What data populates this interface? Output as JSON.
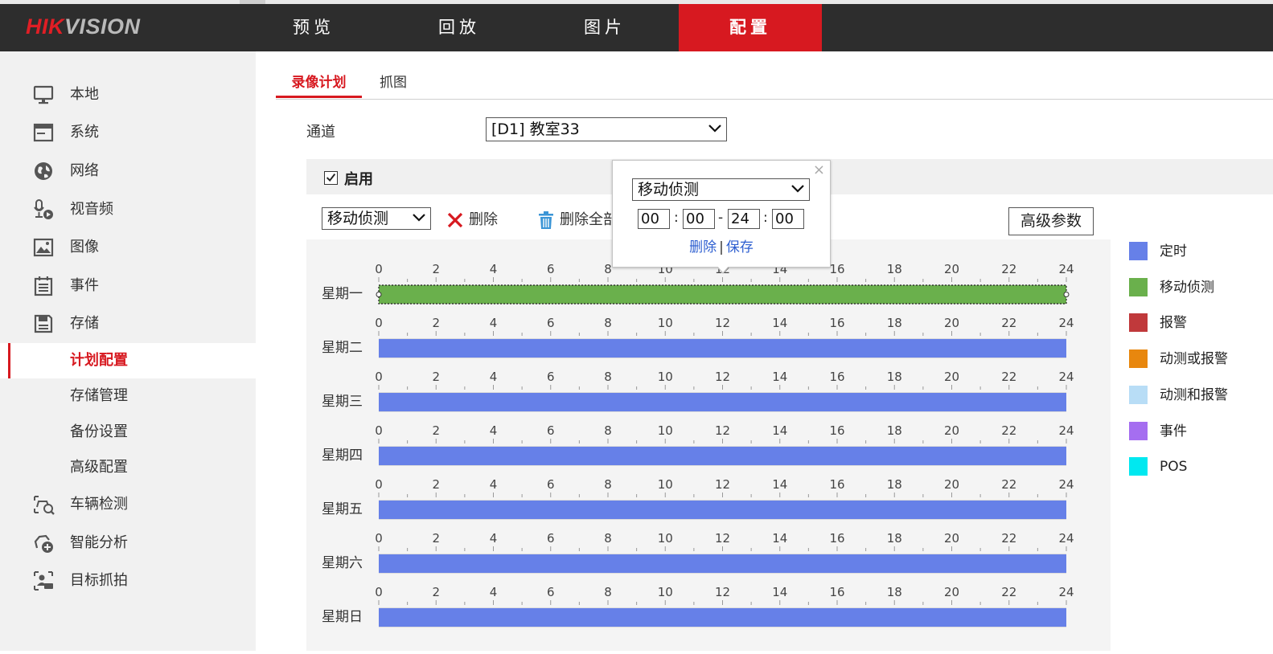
{
  "header": {
    "logo_part1": "HIK",
    "logo_part2": "VISION",
    "tabs": [
      {
        "label": "预览",
        "active": false
      },
      {
        "label": "回放",
        "active": false
      },
      {
        "label": "图片",
        "active": false
      },
      {
        "label": "配置",
        "active": true
      }
    ]
  },
  "sidebar": {
    "items": [
      {
        "label": "本地",
        "icon": "monitor-icon"
      },
      {
        "label": "系统",
        "icon": "system-window-icon"
      },
      {
        "label": "网络",
        "icon": "globe-icon"
      },
      {
        "label": "视音频",
        "icon": "audio-video-icon"
      },
      {
        "label": "图像",
        "icon": "image-icon"
      },
      {
        "label": "事件",
        "icon": "event-list-icon"
      },
      {
        "label": "存储",
        "icon": "storage-disk-icon"
      }
    ],
    "sub_items": [
      {
        "label": "计划配置",
        "active": true
      },
      {
        "label": "存储管理",
        "active": false
      },
      {
        "label": "备份设置",
        "active": false
      },
      {
        "label": "高级配置",
        "active": false
      }
    ],
    "items2": [
      {
        "label": "车辆检测",
        "icon": "vehicle-detection-icon"
      },
      {
        "label": "智能分析",
        "icon": "smart-analysis-icon"
      },
      {
        "label": "目标抓拍",
        "icon": "target-capture-icon"
      }
    ]
  },
  "subtabs": [
    {
      "label": "录像计划",
      "active": true
    },
    {
      "label": "抓图",
      "active": false
    }
  ],
  "channel": {
    "label": "通道",
    "value": "[D1] 教室33"
  },
  "enable": {
    "label": "启用",
    "checked": true
  },
  "toolbar": {
    "type_value": "移动侦测",
    "delete_label": "删除",
    "delete_all_label": "删除全部",
    "advanced_label": "高级参数"
  },
  "popup": {
    "type_value": "移动侦测",
    "start_hour": "00",
    "start_min": "00",
    "end_hour": "24",
    "end_min": "00",
    "colon": ":",
    "dash": "-",
    "delete_link": "删除",
    "divider": "|",
    "save_link": "保存",
    "close": "×"
  },
  "schedule": {
    "tick_labels": [
      "0",
      "2",
      "4",
      "6",
      "8",
      "10",
      "12",
      "14",
      "16",
      "18",
      "20",
      "22",
      "24"
    ],
    "days": [
      {
        "label": "星期一",
        "type": "移动侦测",
        "start": 0,
        "end": 24,
        "selected": true
      },
      {
        "label": "星期二",
        "type": "定时",
        "start": 0,
        "end": 24,
        "selected": false
      },
      {
        "label": "星期三",
        "type": "定时",
        "start": 0,
        "end": 24,
        "selected": false
      },
      {
        "label": "星期四",
        "type": "定时",
        "start": 0,
        "end": 24,
        "selected": false
      },
      {
        "label": "星期五",
        "type": "定时",
        "start": 0,
        "end": 24,
        "selected": false
      },
      {
        "label": "星期六",
        "type": "定时",
        "start": 0,
        "end": 24,
        "selected": false
      },
      {
        "label": "星期日",
        "type": "定时",
        "start": 0,
        "end": 24,
        "selected": false
      }
    ]
  },
  "legend": [
    {
      "label": "定时",
      "color": "#6680e8"
    },
    {
      "label": "移动侦测",
      "color": "#6ab04c"
    },
    {
      "label": "报警",
      "color": "#c0393b"
    },
    {
      "label": "动测或报警",
      "color": "#e8870e"
    },
    {
      "label": "动测和报警",
      "color": "#b8ddf6"
    },
    {
      "label": "事件",
      "color": "#a56ef0"
    },
    {
      "label": "POS",
      "color": "#00e8f0"
    }
  ],
  "colors": {
    "accent": "#d71920",
    "header_bg": "#2d2d2d",
    "link": "#2e5fd0"
  }
}
